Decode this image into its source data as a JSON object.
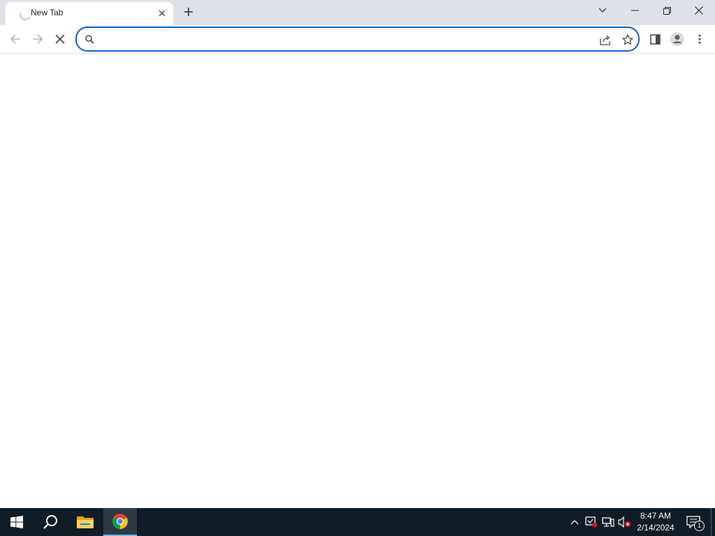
{
  "browser": {
    "tab": {
      "title": "New Tab",
      "loading": true
    },
    "omnibox": {
      "value": "",
      "placeholder": ""
    },
    "icons": {
      "tab_close": "close-icon",
      "new_tab": "plus-icon",
      "tab_search": "chevron-down-icon",
      "minimize": "minimize-icon",
      "restore": "restore-icon",
      "close_window": "close-icon",
      "back": "arrow-left-icon",
      "forward": "arrow-right-icon",
      "stop": "stop-icon",
      "search": "search-icon",
      "share": "share-icon",
      "bookmark": "star-icon",
      "side_panel": "side-panel-icon",
      "profile": "profile-icon",
      "menu": "more-vert-icon"
    },
    "colors": {
      "tabstrip": "#dee1e6",
      "omnibox_focus": "#0b57d0",
      "disabled_icon": "#b0b4b8",
      "icon": "#474747"
    }
  },
  "taskbar": {
    "items": [
      "start-icon",
      "search-icon",
      "file-explorer-icon",
      "chrome-icon"
    ],
    "active_item": "chrome-icon",
    "tray": [
      "chevron-up-icon",
      "security-alert-icon",
      "network-icon",
      "volume-muted-icon"
    ],
    "clock": {
      "time": "8:47 AM",
      "date": "2/14/2024"
    },
    "notifications": {
      "count": "1"
    },
    "colors": {
      "background": "#101c26",
      "active": "#2c3a46",
      "accent": "#76b9ed"
    }
  }
}
